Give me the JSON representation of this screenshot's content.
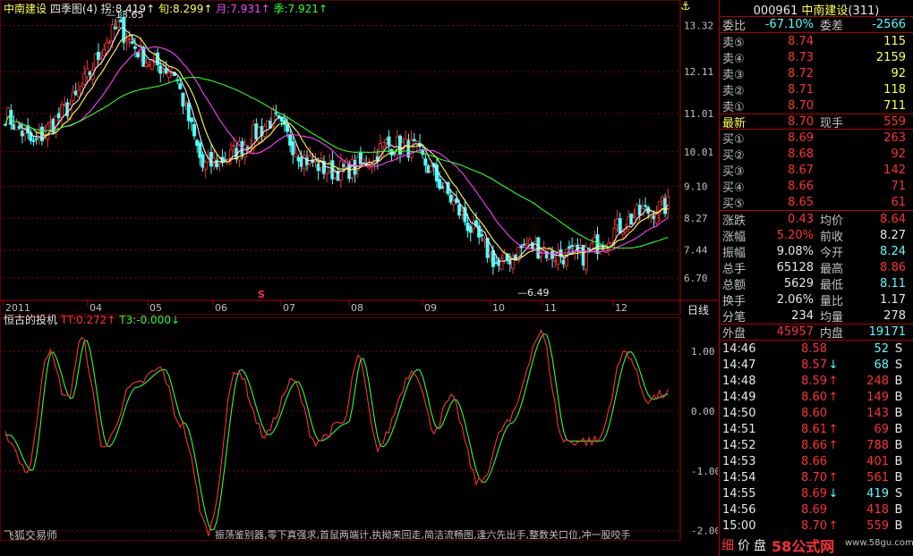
{
  "header": {
    "stock_name": "中南建设",
    "indicator": "四季图(4)",
    "ma_items": [
      {
        "label": "拐:8.419",
        "arrow": "↑",
        "color": "#e8e8e8"
      },
      {
        "label": "旬:8.299",
        "arrow": "↑",
        "color": "#ffff54"
      },
      {
        "label": "月:7.931",
        "arrow": "↑",
        "color": "#ff40ff"
      },
      {
        "label": "季:7.921",
        "arrow": "↑",
        "color": "#2dff2d"
      }
    ],
    "anchor_icon": "⚓"
  },
  "price_axis": [
    "13.32",
    "12.11",
    "11.01",
    "10.01",
    "9.10",
    "8.27",
    "7.44",
    "6.70"
  ],
  "month_axis": [
    "2011",
    "04",
    "05",
    "06",
    "07",
    "08",
    "09",
    "10",
    "11",
    "12"
  ],
  "period": "日线",
  "high_marker": "13.65",
  "low_marker": "6.49",
  "s_marker": "S",
  "oscillator": {
    "title": "恒古的投机",
    "tt": "TT:0.272",
    "tt_arrow": "↑",
    "t3": "T3:-0.000",
    "t3_arrow": "↓",
    "axis": [
      "1.00",
      "0.00",
      "-1.00",
      "-2.00"
    ]
  },
  "platform": "飞狐交易师",
  "formula_list": "振荡鉴别器,零下真强求,首鼠两端计,执拗来回走,简洁流畅图,逢六先出手,整数关口位,冲一股咬手",
  "panel": {
    "code": "000961",
    "name": "中南建设",
    "count": "(311)",
    "ratio_label": "委比",
    "ratio_value": "-67.10%",
    "diff_label": "委差",
    "diff_value": "-2566",
    "asks": [
      {
        "label": "卖⑤",
        "price": "8.74",
        "vol": "115"
      },
      {
        "label": "卖④",
        "price": "8.73",
        "vol": "2159"
      },
      {
        "label": "卖③",
        "price": "8.72",
        "vol": "92"
      },
      {
        "label": "卖②",
        "price": "8.71",
        "vol": "118"
      },
      {
        "label": "卖①",
        "price": "8.70",
        "vol": "711"
      }
    ],
    "latest": {
      "label": "最新",
      "price": "8.70",
      "label2": "现手",
      "vol": "559"
    },
    "bids": [
      {
        "label": "买①",
        "price": "8.69",
        "vol": "263"
      },
      {
        "label": "买②",
        "price": "8.68",
        "vol": "92"
      },
      {
        "label": "买③",
        "price": "8.67",
        "vol": "142"
      },
      {
        "label": "买④",
        "price": "8.66",
        "vol": "71"
      },
      {
        "label": "买⑤",
        "price": "8.65",
        "vol": "61"
      }
    ],
    "stats": [
      {
        "k": "涨跌",
        "v": "0.43",
        "vc": "#ff3232",
        "k2": "均价",
        "v2": "8.64",
        "v2c": "#ff3232"
      },
      {
        "k": "涨幅",
        "v": "5.20%",
        "vc": "#ff3232",
        "k2": "前收",
        "v2": "8.27",
        "v2c": "#e8e8e8"
      },
      {
        "k": "振幅",
        "v": "9.08%",
        "vc": "#e8e8e8",
        "k2": "今开",
        "v2": "8.24",
        "v2c": "#54ffff"
      },
      {
        "k": "总手",
        "v": "65128",
        "vc": "#e8e8e8",
        "k2": "最高",
        "v2": "8.86",
        "v2c": "#ff3232"
      },
      {
        "k": "总额",
        "v": "5629",
        "vc": "#e8e8e8",
        "k2": "最低",
        "v2": "8.11",
        "v2c": "#54ffff"
      },
      {
        "k": "换手",
        "v": "2.06%",
        "vc": "#e8e8e8",
        "k2": "量比",
        "v2": "1.17",
        "v2c": "#e8e8e8"
      },
      {
        "k": "分笔",
        "v": "234",
        "vc": "#e8e8e8",
        "k2": "均量",
        "v2": "278",
        "v2c": "#e8e8e8"
      }
    ],
    "outer_label": "外盘",
    "outer_value": "45957",
    "inner_label": "内盘",
    "inner_value": "19171",
    "ticks": [
      {
        "t": "14:46",
        "p": "8.58",
        "a": "",
        "ac": "#ff3232",
        "v": "52",
        "vc": "#54ffff",
        "bs": "S"
      },
      {
        "t": "14:47",
        "p": "8.57",
        "a": "↓",
        "ac": "#54ffff",
        "v": "68",
        "vc": "#54ffff",
        "bs": "S"
      },
      {
        "t": "14:48",
        "p": "8.59",
        "a": "↑",
        "ac": "#ff3232",
        "v": "248",
        "vc": "#ff3232",
        "bs": "B"
      },
      {
        "t": "14:49",
        "p": "8.60",
        "a": "↑",
        "ac": "#ff3232",
        "v": "149",
        "vc": "#ff3232",
        "bs": "B"
      },
      {
        "t": "14:50",
        "p": "8.60",
        "a": "",
        "ac": "#ff3232",
        "v": "143",
        "vc": "#ff3232",
        "bs": "B"
      },
      {
        "t": "14:51",
        "p": "8.61",
        "a": "↑",
        "ac": "#ff3232",
        "v": "69",
        "vc": "#ff3232",
        "bs": "B"
      },
      {
        "t": "14:52",
        "p": "8.66",
        "a": "↑",
        "ac": "#ff3232",
        "v": "788",
        "vc": "#ff3232",
        "bs": "B"
      },
      {
        "t": "14:53",
        "p": "8.66",
        "a": "",
        "ac": "#ff3232",
        "v": "401",
        "vc": "#ff3232",
        "bs": "B"
      },
      {
        "t": "14:54",
        "p": "8.70",
        "a": "↑",
        "ac": "#ff3232",
        "v": "561",
        "vc": "#ff3232",
        "bs": "B"
      },
      {
        "t": "14:55",
        "p": "8.69",
        "a": "↓",
        "ac": "#54ffff",
        "v": "419",
        "vc": "#54ffff",
        "bs": "S"
      },
      {
        "t": "14:56",
        "p": "8.69",
        "a": "",
        "ac": "#ff3232",
        "v": "418",
        "vc": "#ff3232",
        "bs": "B"
      },
      {
        "t": "15:00",
        "p": "8.70",
        "a": "↑",
        "ac": "#ff3232",
        "v": "559",
        "vc": "#ff3232",
        "bs": "B"
      }
    ],
    "tabs": [
      "细",
      "价",
      "盘"
    ],
    "watermark": "58公式网",
    "watermark_url": "www.58gu.com"
  },
  "colors": {
    "up": "#ff3232",
    "down": "#54ffff",
    "grid": "#8b0000",
    "border": "#b40000"
  },
  "chart_data": [
    {
      "type": "line",
      "title": "",
      "x": [
        "2011",
        "04",
        "05",
        "06",
        "07",
        "08",
        "09",
        "10",
        "11",
        "12"
      ],
      "ylim": [
        6.5,
        13.65
      ],
      "series": [
        {
          "name": "拐",
          "values": [
            10.6,
            12.8,
            12.2,
            9.9,
            10.7,
            10.1,
            10.0,
            7.5,
            7.3,
            8.4
          ]
        },
        {
          "name": "旬",
          "values": [
            10.7,
            12.6,
            12.3,
            10.1,
            10.7,
            10.0,
            10.1,
            7.9,
            7.4,
            8.3
          ]
        },
        {
          "name": "月",
          "values": [
            10.8,
            12.3,
            12.3,
            10.6,
            10.6,
            10.1,
            10.2,
            8.4,
            7.6,
            7.93
          ]
        },
        {
          "name": "季",
          "values": [
            11.0,
            11.5,
            12.0,
            11.5,
            10.8,
            10.4,
            10.2,
            8.9,
            8.1,
            7.92
          ]
        }
      ],
      "markers": {
        "high": 13.65,
        "low": 6.49
      }
    },
    {
      "type": "line",
      "title": "",
      "x": [
        "2011",
        "04",
        "05",
        "06",
        "07",
        "08",
        "09",
        "10",
        "11",
        "12"
      ],
      "ylim": [
        -2.0,
        1.4
      ],
      "series": [
        {
          "name": "TT",
          "values": [
            -0.6,
            1.1,
            0.2,
            -2.0,
            0.6,
            -0.4,
            0.6,
            -0.9,
            1.3,
            0.27
          ]
        },
        {
          "name": "T3",
          "values": [
            -0.5,
            1.0,
            0.3,
            -1.9,
            0.5,
            -0.3,
            0.5,
            -0.8,
            1.2,
            0.0
          ]
        }
      ]
    }
  ]
}
